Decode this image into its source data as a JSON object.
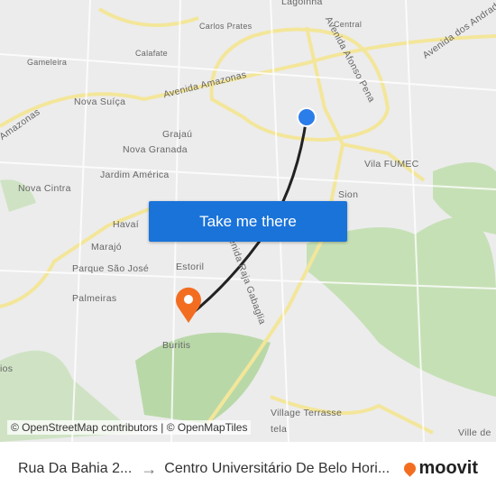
{
  "map": {
    "labels": [
      "Lagoinha",
      "Carlos Prates",
      "Central",
      "Avenida dos Andradas",
      "Avenida Afonso Pena",
      "Calafate",
      "Gameleira",
      "Avenida Amazonas",
      "Amazonas",
      "Nova Suíça",
      "Grajaú",
      "Nova Granada",
      "Jardim América",
      "Vila FUMEC",
      "Sion",
      "Nova Cintra",
      "Havaí",
      "Marajó",
      "Parque São José",
      "Estoril",
      "Avenida Raja Gabaglia",
      "Palmeiras",
      "Buritis",
      "Village Terrasse",
      "Ville de",
      "tela",
      "ios"
    ],
    "origin_color": "#2b7de9",
    "destination_color": "#f36d21",
    "route_color": "#222222"
  },
  "cta": {
    "label": "Take me there",
    "color": "#1a73d9"
  },
  "attribution": "© OpenStreetMap contributors | © OpenMapTiles",
  "footer": {
    "from": "Rua Da Bahia 2...",
    "to": "Centro Universitário De Belo Hori...",
    "brand": "moovit"
  }
}
